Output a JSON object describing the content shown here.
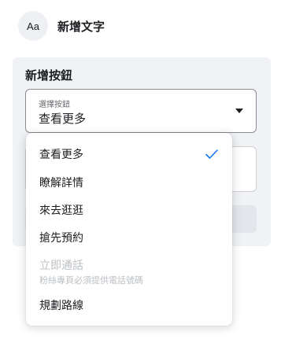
{
  "add_text": {
    "icon_text": "Aa",
    "label": "新增文字"
  },
  "panel": {
    "title": "新增按鈕",
    "select": {
      "caption": "選擇按鈕",
      "value": "查看更多"
    }
  },
  "dropdown": {
    "items": [
      {
        "label": "查看更多",
        "selected": true
      },
      {
        "label": "瞭解詳情"
      },
      {
        "label": "來去逛逛"
      },
      {
        "label": "搶先預約"
      },
      {
        "label": "立即通話",
        "sub": "粉絲專頁必須提供電話號碼",
        "disabled": true
      },
      {
        "label": "規劃路線"
      }
    ]
  },
  "colors": {
    "accent": "#1877f2",
    "panel_bg": "#f0f2f5",
    "disabled_text": "#bcc0c4"
  }
}
